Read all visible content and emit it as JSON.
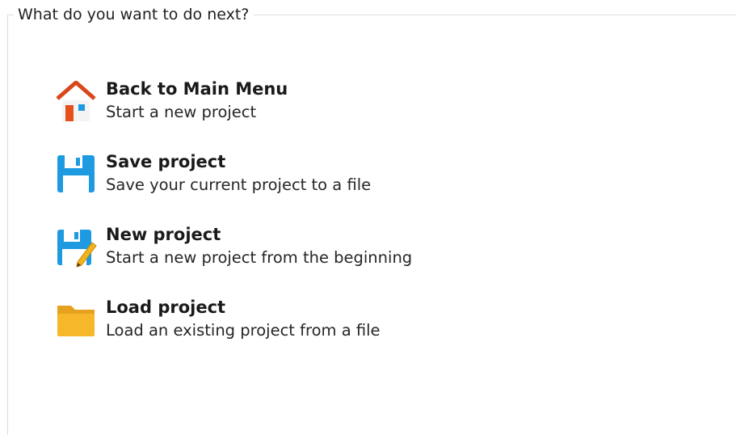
{
  "group": {
    "legend": "What do you want to do next?"
  },
  "actions": [
    {
      "icon": "home-icon",
      "title": "Back to Main Menu",
      "description": "Start a new project"
    },
    {
      "icon": "save-disk-icon",
      "title": "Save project",
      "description": "Save your current project to a file"
    },
    {
      "icon": "new-project-disk-pencil-icon",
      "title": "New project",
      "description": "Start a new project from the beginning"
    },
    {
      "icon": "folder-icon",
      "title": "Load project",
      "description": "Load an existing project from a file"
    }
  ],
  "colors": {
    "home_roof": "#d9481c",
    "home_window": "#1e9be0",
    "disk_blue": "#1e9be0",
    "pencil_yellow": "#f2b21b",
    "folder_yellow": "#f6b82a"
  }
}
